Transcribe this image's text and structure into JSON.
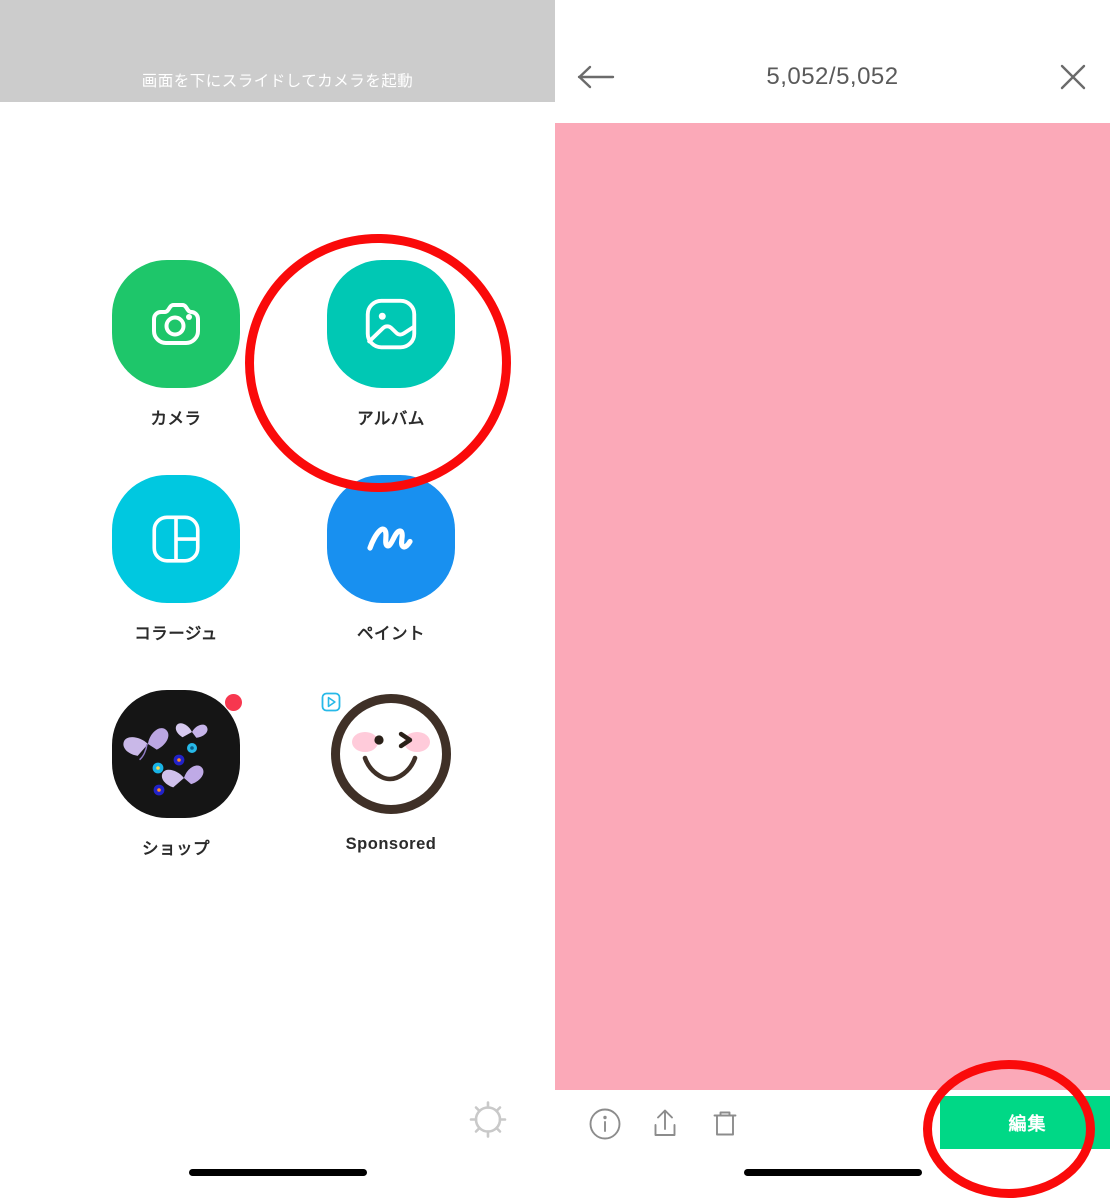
{
  "left_screen": {
    "camera_hint": "画面を下にスライドしてカメラを起動",
    "apps": [
      {
        "label": "カメラ",
        "icon": "camera-icon",
        "color": "#1ec66a"
      },
      {
        "label": "アルバム",
        "icon": "album-photo-icon",
        "color": "#00c8b4"
      },
      {
        "label": "コラージュ",
        "icon": "collage-grid-icon",
        "color": "#00c8e0"
      },
      {
        "label": "ペイント",
        "icon": "paint-brush-stroke-icon",
        "color": "#1890f0"
      },
      {
        "label": "ショップ",
        "icon": "shop-butterfly-sticker-icon",
        "color": "#151515",
        "badge": true
      },
      {
        "label": "Sponsored",
        "icon": "sponsored-smiley-icon",
        "color": "#ffffff",
        "ad_badge": true
      }
    ],
    "settings_icon": "gear-icon"
  },
  "right_screen": {
    "header": {
      "back_icon": "back-arrow-icon",
      "title": "5,052/5,052",
      "close_icon": "close-x-icon"
    },
    "photo": {
      "color": "#fba9b8"
    },
    "toolbar": {
      "info_icon": "info-circle-icon",
      "share_icon": "share-upload-icon",
      "delete_icon": "trash-can-icon",
      "edit_label": "編集"
    }
  },
  "annotations": {
    "color": "#fa0a0a",
    "album_circle": "highlight-album-app",
    "edit_circle": "highlight-edit-button"
  }
}
